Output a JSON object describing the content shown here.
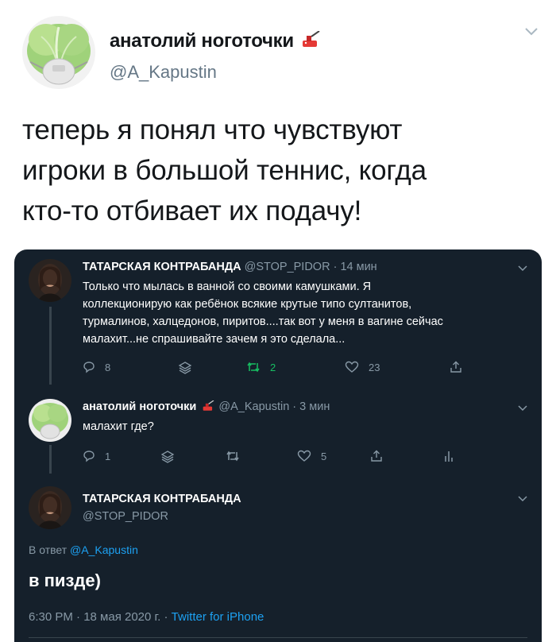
{
  "outer_tweet": {
    "author_name": "анатолий ноготочки",
    "author_handle": "@A_Kapustin",
    "text_lines": [
      "теперь я понял что чувствуют",
      "игроки в большой теннис, когда",
      "кто-то отбивает их подачу!"
    ]
  },
  "embedded": {
    "tweet1": {
      "name": "ТАТАРСКАЯ КОНТРАБАНДА",
      "meta": "@STOP_PIDOR · 14 мин",
      "lines": [
        "Только что мылась в ванной со своими камушками. Я",
        "коллекционирую как ребёнок всякие крутые типо султанитов,",
        "турмалинов, халцедонов, пиритов....так вот у меня в вагине сейчас",
        "малахит...не спрашивайте зачем я это сделала..."
      ],
      "replies": "8",
      "retweets": "2",
      "likes": "23"
    },
    "tweet2": {
      "name": "анатолий ноготочки",
      "meta": "@A_Kapustin · 3 мин",
      "text": "малахит где?",
      "replies": "1",
      "likes": "5"
    },
    "tweet3": {
      "name": "ТАТАРСКАЯ КОНТРАБАНДА",
      "handle": "@STOP_PIDOR",
      "reply_prefix": "В ответ",
      "reply_handle": "@A_Kapustin",
      "text": "в пизде)",
      "time": "6:30 PM · 18 мая 2020 г. · ",
      "source": "Twitter for iPhone"
    }
  },
  "colors": {
    "dark_bg": "#15202b",
    "muted": "#8899a6",
    "accent": "#1da1f2",
    "retweet_green": "#17bf63"
  }
}
